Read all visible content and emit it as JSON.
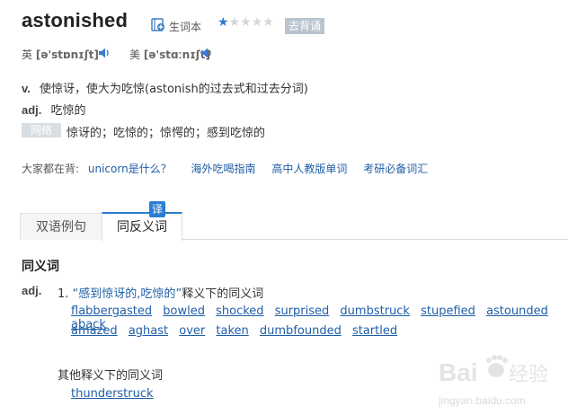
{
  "word": "astonished",
  "wordbook": {
    "label": "生词本",
    "icon": "add-wordbook-icon"
  },
  "rating": {
    "filled": 1,
    "total": 5
  },
  "recite_label": "去背诵",
  "phonetics": {
    "uk": {
      "label": "英",
      "ipa": "[ə'stɒnɪʃt]"
    },
    "us": {
      "label": "美",
      "ipa": "[ə'stɑːnɪʃt]"
    }
  },
  "definitions": [
    {
      "pos": "v.",
      "text": "使惊讶，使大为吃惊(astonish的过去式和过去分词)"
    },
    {
      "pos": "adj.",
      "text": "吃惊的"
    }
  ],
  "web": {
    "tag": "网络",
    "text": "惊讶的；吃惊的；惊愕的；感到吃惊的"
  },
  "hot": {
    "label": "大家都在背:",
    "links": [
      "unicorn是什么？",
      "海外吃喝指南",
      "高中人教版单词",
      "考研必备词汇"
    ]
  },
  "tabs": [
    {
      "label": "双语例句",
      "active": false
    },
    {
      "label": "同反义词",
      "active": true,
      "badge": "译"
    }
  ],
  "synonyms": {
    "title": "同义词",
    "pos": "adj.",
    "sense_number": "1.",
    "sense_quote_open": "“",
    "sense_text": "感到惊讶的,吃惊的",
    "sense_quote_close": "”",
    "sense_suffix": "释义下的同义词",
    "row1": [
      "flabbergasted",
      "bowled",
      "shocked",
      "surprised",
      "dumbstruck",
      "stupefied",
      "astounded",
      "aback"
    ],
    "row2": [
      "amazed",
      "aghast",
      "over",
      "taken",
      "dumbfounded",
      "startled"
    ],
    "other_label": "其他释义下的同义词",
    "other_words": [
      "thunderstruck"
    ]
  },
  "watermark": {
    "brand": "Bai",
    "suffix": "经验",
    "url": "jingyan.baidu.com"
  },
  "colors": {
    "link": "#1f5ea8",
    "accent": "#2b7fd1",
    "star": "#2d7bd0"
  }
}
